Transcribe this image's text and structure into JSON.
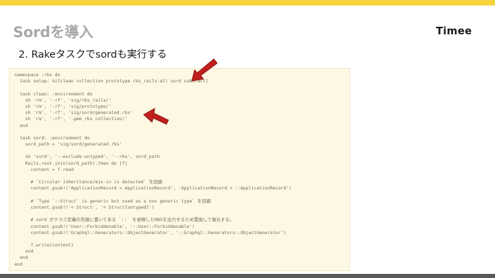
{
  "slide": {
    "title": "Sordを導入",
    "subtitle": "2. Rakeタスクでsordも実行する",
    "logo": "Timee"
  },
  "colors": {
    "top_bar": "#f6d53c",
    "bottom_bar": "#5a5a5a",
    "code_background": "#fdf8e3",
    "arrow": "#c0201e"
  },
  "icons": [
    "arrow-icon",
    "arrow-icon"
  ],
  "code_lines": [
    "namespace :rbs do",
    "  task setup: %i[clean collection prototype rbs_rails:all sord subtract]",
    "",
    "  task clean: :environment do",
    "    sh 'rm', '-rf', 'sig/rbs_rails/'",
    "    sh 'rm', '-rf', 'sig/prototype/'",
    "    sh 'rm', '-rf', 'sig/sord/generated.rbs'",
    "    sh 'rm', '-rf', '.gem_rbs_collection/'",
    "  end",
    "",
    "  task sord: :environment do",
    "    sord_path = 'sig/sord/generated.rbs'",
    "",
    "    sh 'sord', '--exclude-untyped', '--rbs', sord_path",
    "    Rails.root.join(sord_path).then do |f|",
    "      content = f.read",
    "",
    "      # `Circular inheritance/mix-in is detected` を回避",
    "      content.gsub!('ApplicationRecord < ApplicationRecord', 'ApplicationRecord < ::ApplicationRecord')",
    "",
    "      # `Type `::Struct` is generic but used as a non generic type` を回避",
    "      content.gsub!('< Struct', '< Struct[untyped]')",
    "",
    "      # sord がクラス定義の先頭に書いてある `::` を省略したRBSを出力するため置換して復元する。",
    "      content.gsub!('User::Forbiddenable', '::User::Forbiddenable')",
    "      content.gsub!('Graphql::Generators::ObjectGenerator', '::Graphql::Generators::ObjectGenerator')",
    "",
    "      f.write(content)",
    "    end",
    "  end",
    "end"
  ]
}
